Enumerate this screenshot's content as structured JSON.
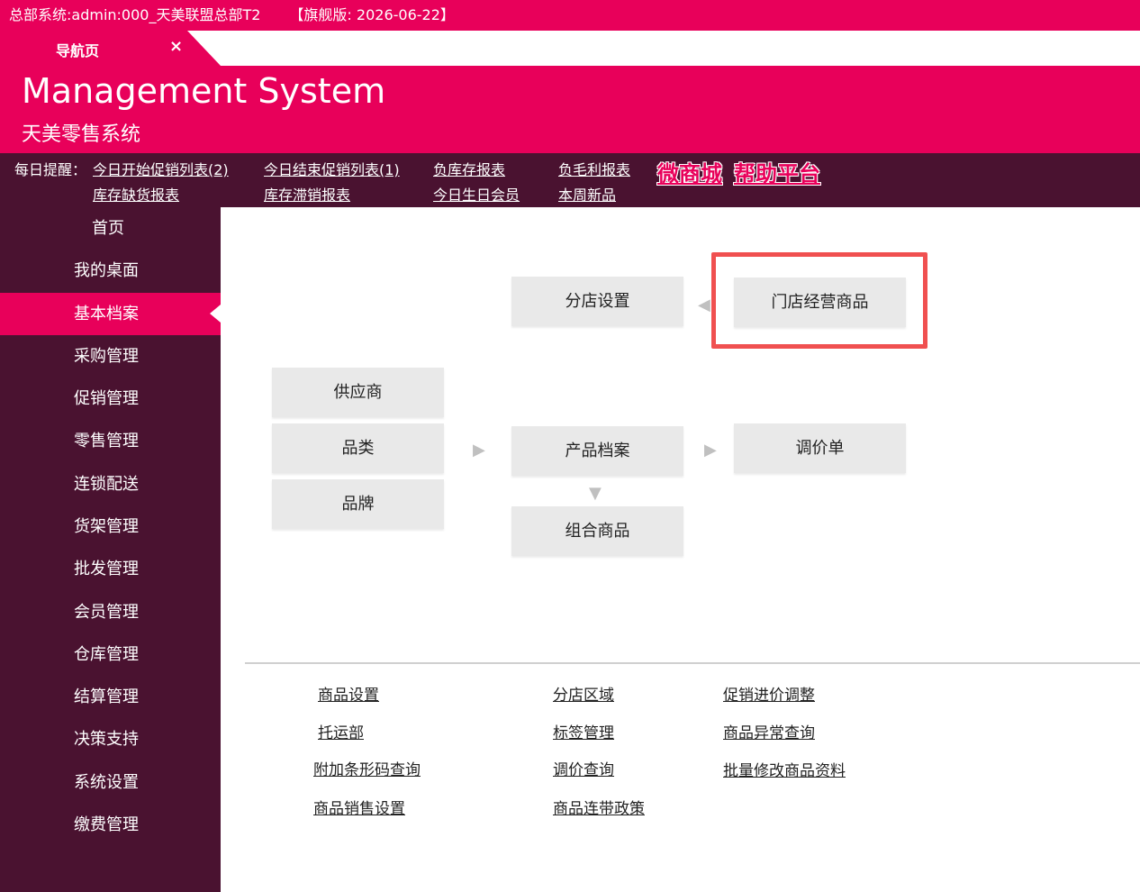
{
  "titlebar": {
    "system": "总部系统:admin:000_天美联盟总部T2",
    "version": "【旗舰版: 2026-06-22】"
  },
  "tab": {
    "label": "导航页",
    "close": "×"
  },
  "header": {
    "title": "Management System",
    "subtitle": "天美零售系统"
  },
  "reminders": {
    "label": "每日提醒：",
    "links": [
      "今日开始促销列表(2)",
      "今日结束促销列表(1)",
      "负库存报表",
      "负毛利报表",
      "库存缺货报表",
      "库存滞销报表",
      "今日生日会员",
      "本周新品"
    ],
    "big_links": [
      "微商城",
      "帮助平台"
    ]
  },
  "sidebar": {
    "items": [
      "首页",
      "我的桌面",
      "基本档案",
      "采购管理",
      "促销管理",
      "零售管理",
      "连锁配送",
      "货架管理",
      "批发管理",
      "会员管理",
      "仓库管理",
      "结算管理",
      "决策支持",
      "系统设置",
      "缴费管理"
    ],
    "active_index": 2
  },
  "diagram": {
    "branch_settings": "分店设置",
    "store_products": "门店经营商品",
    "supplier": "供应商",
    "category": "品类",
    "brand": "品牌",
    "product_archive": "产品档案",
    "price_adjust": "调价单",
    "combo_product": "组合商品"
  },
  "arrows": {
    "left": "◀",
    "right": "▶",
    "down": "▼"
  },
  "quick_links": {
    "col1": [
      "商品设置",
      "托运部",
      "附加条形码查询",
      "商品销售设置"
    ],
    "col2": [
      "分店区域",
      "标签管理",
      "调价查询",
      "商品连带政策"
    ],
    "col3": [
      "促销进价调整",
      "商品异常查询",
      "批量修改商品资料"
    ]
  },
  "colors": {
    "brand": "#e8005a",
    "dark": "#4a1230",
    "highlight": "#f05050"
  }
}
